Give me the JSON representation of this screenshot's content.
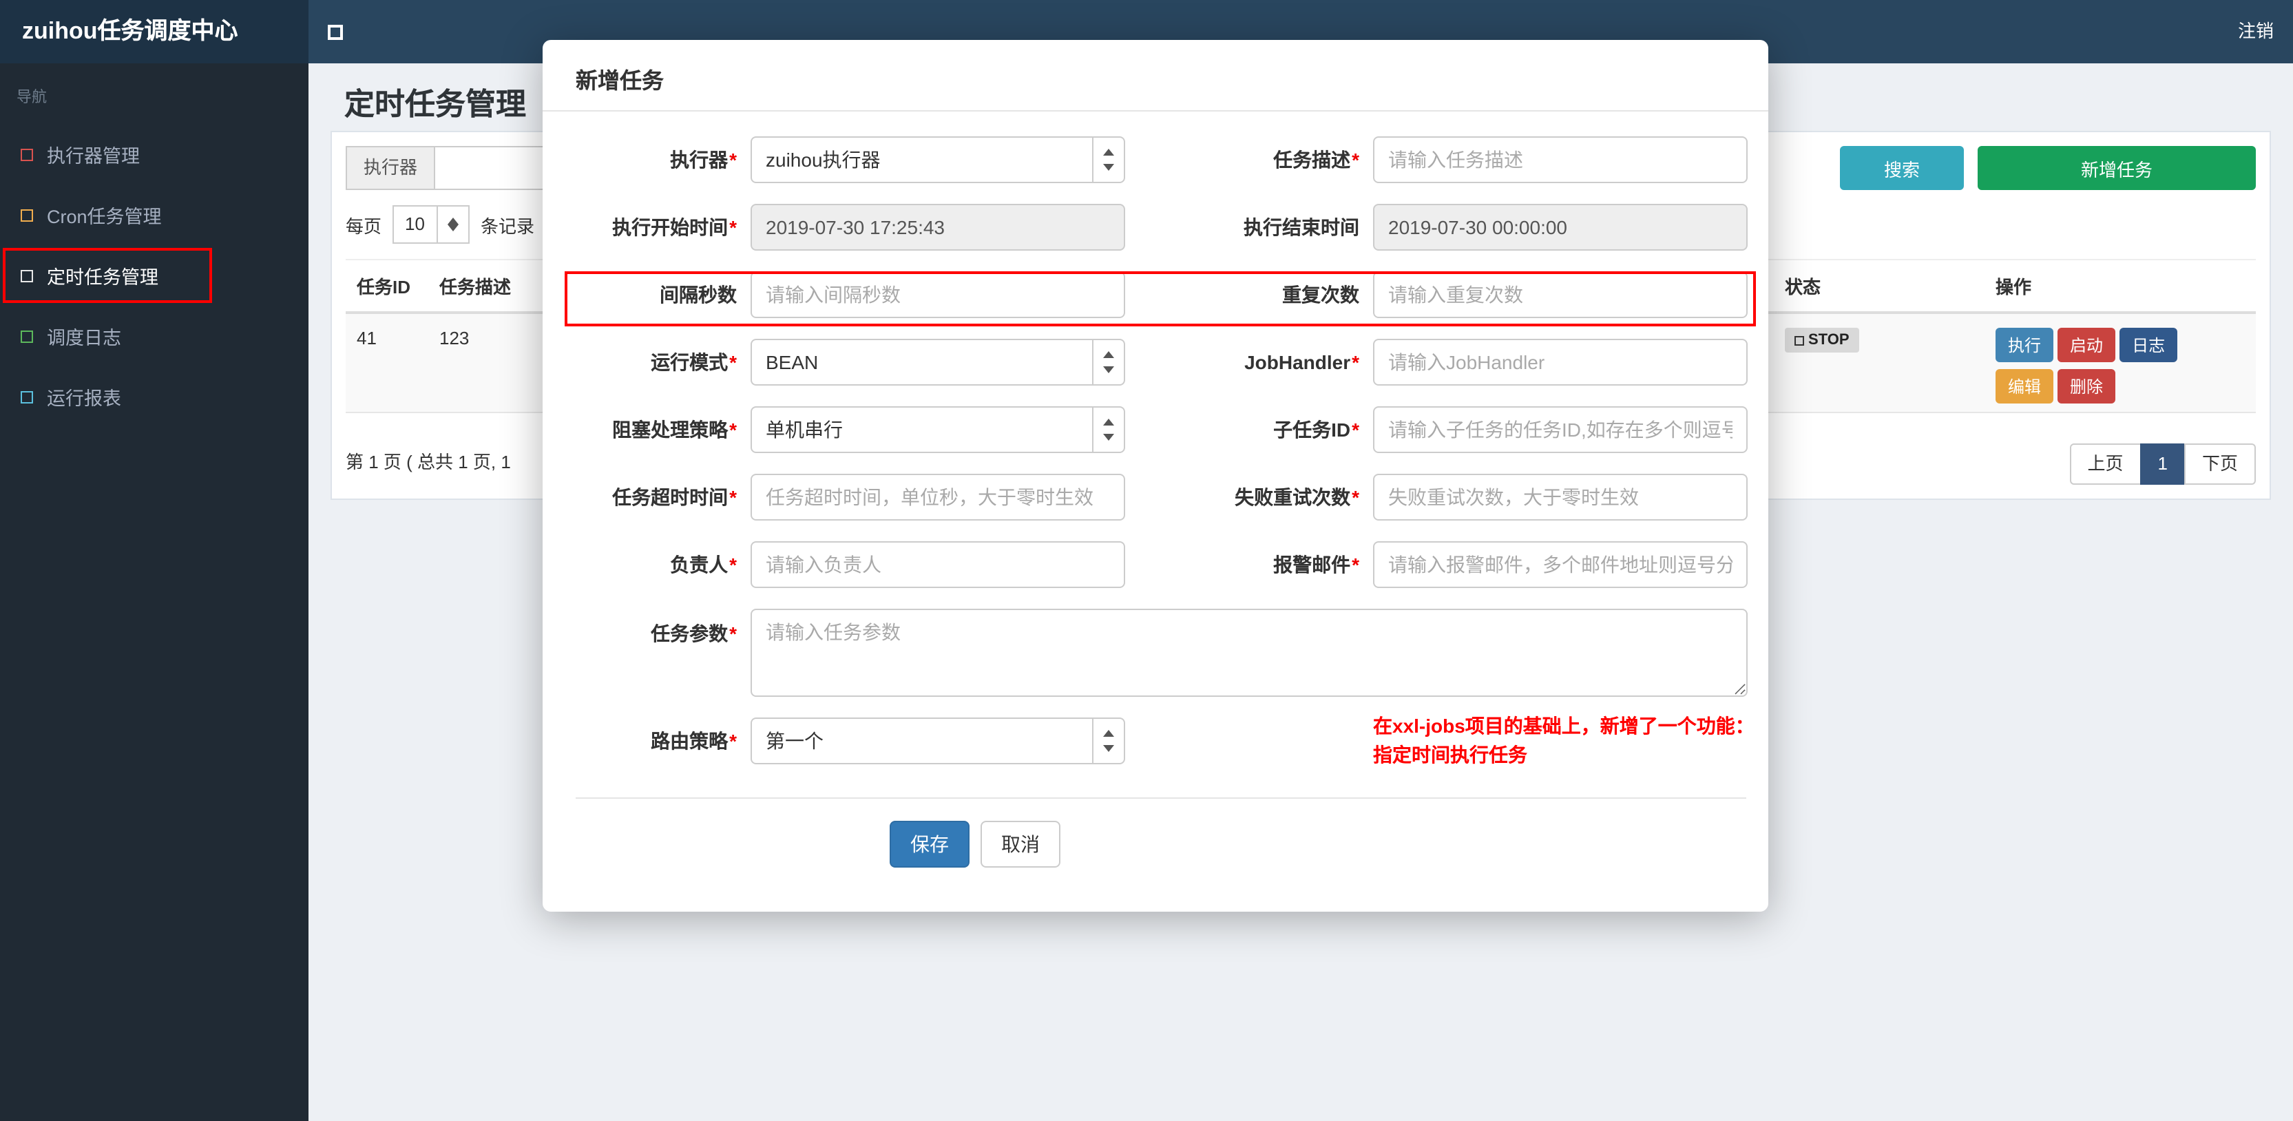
{
  "colors": {
    "topbar_bg": "#29465f",
    "brand_bg": "#1d3245",
    "sidebar_bg": "#202a34",
    "search_button": "#35a9bd",
    "add_button": "#17a05a",
    "save_button": "#337ab7",
    "active_page": "#36557d",
    "annotation_red": "#ff0000",
    "note_red": "#ff0000",
    "icon_executor": "#d9534f",
    "icon_cron": "#f0ad4e",
    "icon_timed": "#e8e8e8",
    "icon_log": "#5cb85c",
    "icon_report": "#5bc0de"
  },
  "topbar": {
    "brand": "zuihou任务调度中心",
    "logout": "注销"
  },
  "sidebar": {
    "nav_label": "导航",
    "items": [
      {
        "label": "执行器管理",
        "icon": "square-outline-icon"
      },
      {
        "label": "Cron任务管理",
        "icon": "square-outline-icon"
      },
      {
        "label": "定时任务管理",
        "icon": "square-outline-icon",
        "active": true
      },
      {
        "label": "调度日志",
        "icon": "square-outline-icon"
      },
      {
        "label": "运行报表",
        "icon": "square-outline-icon"
      }
    ]
  },
  "page": {
    "title": "定时任务管理"
  },
  "toolbar": {
    "filter_label": "执行器",
    "search": "搜索",
    "add": "新增任务"
  },
  "per_page": {
    "prefix": "每页",
    "value": "10",
    "suffix": "条记录"
  },
  "table": {
    "headers": {
      "id": "任务ID",
      "desc": "任务描述",
      "status": "状态",
      "actions": "操作"
    },
    "row": {
      "id": "41",
      "desc": "123",
      "status": "STOP",
      "buttons": [
        "执行",
        "启动",
        "日志",
        "编辑",
        "删除"
      ]
    }
  },
  "pagination": {
    "info": "第 1 页 ( 总共 1 页, 1",
    "prev": "上页",
    "page": "1",
    "next": "下页"
  },
  "modal": {
    "title": "新增任务",
    "star": "*",
    "fields": {
      "executor": {
        "label": "执行器",
        "value": "zuihou执行器"
      },
      "job_desc": {
        "label": "任务描述",
        "placeholder": "请输入任务描述"
      },
      "start_time": {
        "label": "执行开始时间",
        "value": "2019-07-30 17:25:43"
      },
      "end_time": {
        "label": "执行结束时间",
        "value": "2019-07-30 00:00:00"
      },
      "interval": {
        "label": "间隔秒数",
        "placeholder": "请输入间隔秒数"
      },
      "repeat": {
        "label": "重复次数",
        "placeholder": "请输入重复次数"
      },
      "glue_type": {
        "label": "运行模式",
        "value": "BEAN"
      },
      "job_handler": {
        "label": "JobHandler",
        "placeholder": "请输入JobHandler"
      },
      "block_strategy": {
        "label": "阻塞处理策略",
        "value": "单机串行"
      },
      "child_job": {
        "label": "子任务ID",
        "placeholder": "请输入子任务的任务ID,如存在多个则逗号分隔"
      },
      "timeout": {
        "label": "任务超时时间",
        "placeholder": "任务超时时间，单位秒，大于零时生效"
      },
      "retry": {
        "label": "失败重试次数",
        "placeholder": "失败重试次数，大于零时生效"
      },
      "owner": {
        "label": "负责人",
        "placeholder": "请输入负责人"
      },
      "alarm_email": {
        "label": "报警邮件",
        "placeholder": "请输入报警邮件，多个邮件地址则逗号分隔"
      },
      "job_param": {
        "label": "任务参数",
        "placeholder": "请输入任务参数"
      },
      "route_strategy": {
        "label": "路由策略",
        "value": "第一个"
      }
    },
    "note_line1": "在xxl-jobs项目的基础上，新增了一个功能：",
    "note_line2": "指定时间执行任务",
    "save": "保存",
    "cancel": "取消"
  }
}
